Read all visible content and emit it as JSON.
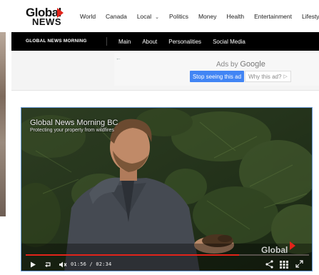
{
  "brand": {
    "line1": "Global",
    "line2": "NEWS",
    "accent": "#e2231a"
  },
  "top_nav": {
    "items": [
      "World",
      "Canada",
      "Local",
      "Politics",
      "Money",
      "Health",
      "Entertainment",
      "Lifestyl"
    ],
    "local_dropdown_icon": "chevron-down-icon"
  },
  "sub_nav": {
    "show": "GLOBAL NEWS MORNING",
    "items": [
      "Main",
      "About",
      "Personalities",
      "Social Media"
    ]
  },
  "ad": {
    "back_icon": "back-arrow-icon",
    "ads_by": "Ads by",
    "google": "Google",
    "stop_label": "Stop seeing this ad",
    "why_label": "Why this ad?",
    "why_icon": "play-triangle-icon",
    "stop_color": "#4285f4"
  },
  "video": {
    "title": "Global News Morning BC",
    "subtitle": "Protecting your property from wildfires",
    "watermark": "Global",
    "current_time": "01:56",
    "duration": "02:34",
    "time_separator": "/",
    "progress_fraction": 0.7532,
    "controls": {
      "play": "play-icon",
      "replay": "replay-icon",
      "volume": "volume-muted-icon",
      "share": "share-icon",
      "grid": "grid-icon",
      "fullscreen": "fullscreen-icon"
    }
  }
}
